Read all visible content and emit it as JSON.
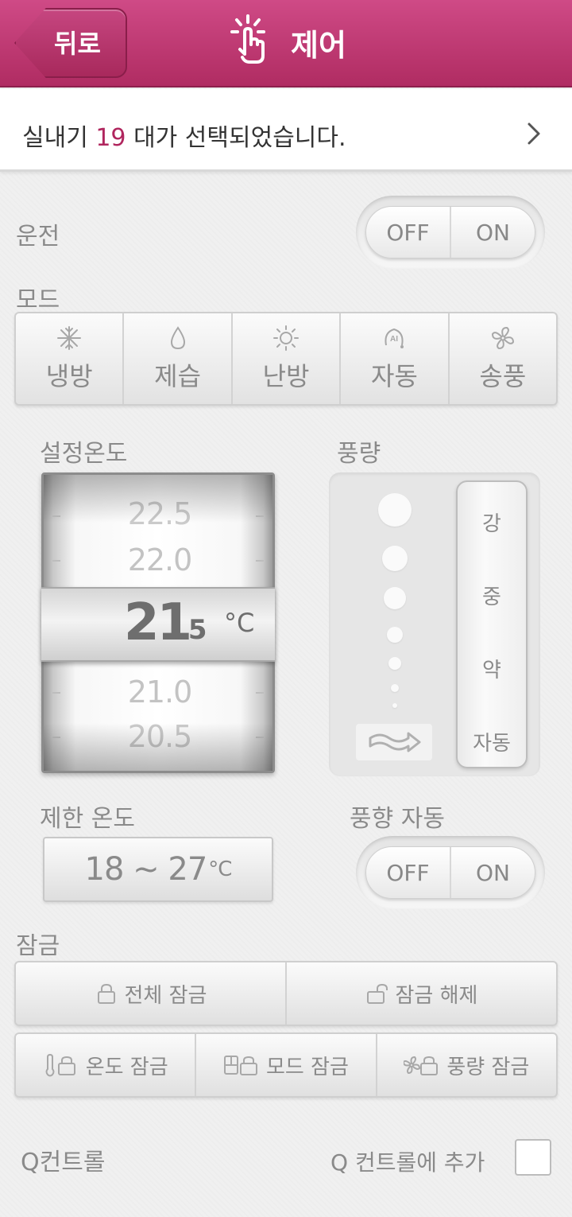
{
  "header": {
    "back_label": "뒤로",
    "title": "제어"
  },
  "selection": {
    "prefix": "실내기 ",
    "count": "19",
    "suffix": " 대가 선택되었습니다."
  },
  "operation": {
    "label": "운전",
    "off": "OFF",
    "on": "ON"
  },
  "mode": {
    "label": "모드",
    "options": [
      {
        "label": "냉방",
        "icon": "snowflake-icon"
      },
      {
        "label": "제습",
        "icon": "droplet-icon"
      },
      {
        "label": "난방",
        "icon": "sun-icon"
      },
      {
        "label": "자동",
        "icon": "ai-auto-icon"
      },
      {
        "label": "송풍",
        "icon": "fan-icon"
      }
    ]
  },
  "set_temp": {
    "label": "설정온도",
    "values": [
      "22.5",
      "22.0",
      "21.0",
      "20.5"
    ],
    "current_int": "21",
    "current_dec": ".5",
    "unit": "°C"
  },
  "fan_speed": {
    "label": "풍량",
    "options": [
      "강",
      "중",
      "약",
      "자동"
    ],
    "auto_icon": "wind-arrow-icon"
  },
  "limit_temp": {
    "label": "제한 온도",
    "range": "18 ~ 27",
    "unit": "°C"
  },
  "swing": {
    "label": "풍향 자동",
    "off": "OFF",
    "on": "ON"
  },
  "lock": {
    "label": "잠금",
    "all_lock": "전체 잠금",
    "unlock": "잠금 해제",
    "temp_lock": "온도 잠금",
    "mode_lock": "모드 잠금",
    "fan_lock": "풍량 잠금"
  },
  "q_control": {
    "label": "Q컨트롤",
    "add_label": "Q 컨트롤에 추가"
  }
}
